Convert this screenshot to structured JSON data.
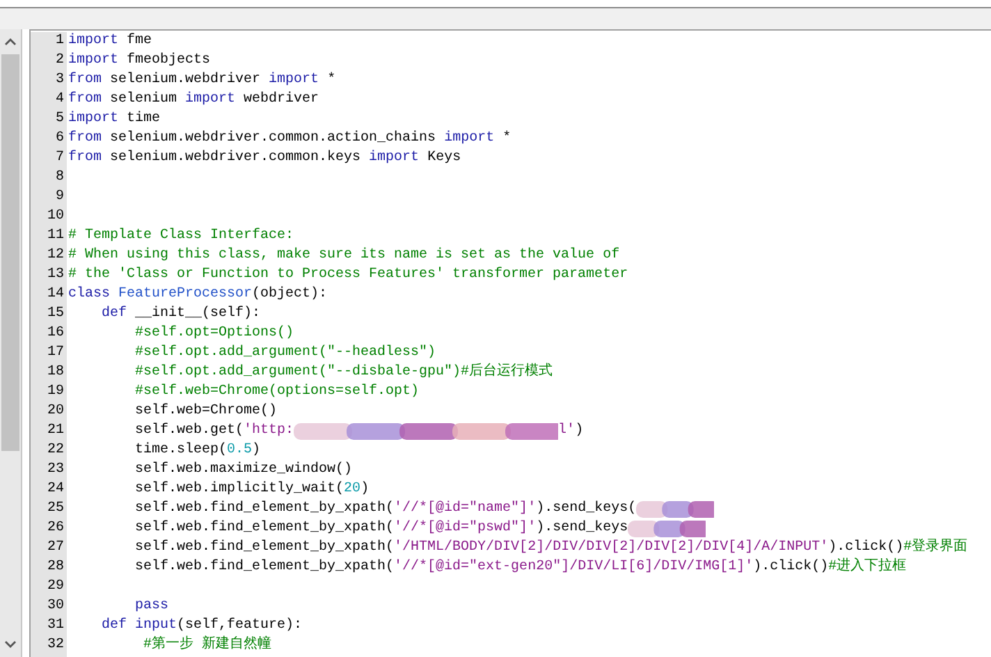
{
  "scrollbar": {
    "kind": "vertical"
  },
  "lines": [
    {
      "number": "1",
      "tokens": [
        {
          "kind": "kw",
          "text": "import"
        },
        {
          "kind": "plain",
          "text": " fme"
        }
      ]
    },
    {
      "number": "2",
      "tokens": [
        {
          "kind": "kw",
          "text": "import"
        },
        {
          "kind": "plain",
          "text": " fmeobjects"
        }
      ]
    },
    {
      "number": "3",
      "tokens": [
        {
          "kind": "kw",
          "text": "from"
        },
        {
          "kind": "plain",
          "text": " selenium.webdriver "
        },
        {
          "kind": "kw",
          "text": "import"
        },
        {
          "kind": "plain",
          "text": " *"
        }
      ]
    },
    {
      "number": "4",
      "tokens": [
        {
          "kind": "kw",
          "text": "from"
        },
        {
          "kind": "plain",
          "text": " selenium "
        },
        {
          "kind": "kw",
          "text": "import"
        },
        {
          "kind": "plain",
          "text": " webdriver"
        }
      ]
    },
    {
      "number": "5",
      "tokens": [
        {
          "kind": "kw",
          "text": "import"
        },
        {
          "kind": "plain",
          "text": " time"
        }
      ]
    },
    {
      "number": "6",
      "tokens": [
        {
          "kind": "kw",
          "text": "from"
        },
        {
          "kind": "plain",
          "text": " selenium.webdriver.common.action_chains "
        },
        {
          "kind": "kw",
          "text": "import"
        },
        {
          "kind": "plain",
          "text": " *"
        }
      ]
    },
    {
      "number": "7",
      "tokens": [
        {
          "kind": "kw",
          "text": "from"
        },
        {
          "kind": "plain",
          "text": " selenium.webdriver.common.keys "
        },
        {
          "kind": "kw",
          "text": "import"
        },
        {
          "kind": "plain",
          "text": " Keys"
        }
      ]
    },
    {
      "number": "8"
    },
    {
      "number": "9"
    },
    {
      "number": "10"
    },
    {
      "number": "11",
      "tokens": [
        {
          "kind": "comment",
          "text": "# Template Class Interface:"
        }
      ]
    },
    {
      "number": "12",
      "tokens": [
        {
          "kind": "comment",
          "text": "# When using this class, make sure its name is set as the value of"
        }
      ]
    },
    {
      "number": "13",
      "tokens": [
        {
          "kind": "comment",
          "text": "# the 'Class or Function to Process Features' transformer parameter"
        }
      ]
    },
    {
      "number": "14",
      "tokens": [
        {
          "kind": "kw",
          "text": "class"
        },
        {
          "kind": "name",
          "text": " FeatureProcessor"
        },
        {
          "kind": "plain",
          "text": "(object):"
        }
      ]
    },
    {
      "number": "15",
      "tokens": [
        {
          "kind": "kw",
          "text": "    def"
        },
        {
          "kind": "plain",
          "text": " __init__(self):"
        }
      ]
    },
    {
      "number": "16",
      "tokens": [
        {
          "kind": "comment",
          "text": "        #self.opt=Options()"
        }
      ]
    },
    {
      "number": "17",
      "tokens": [
        {
          "kind": "comment",
          "text": "        #self.opt.add_argument(\"--headless\")"
        }
      ]
    },
    {
      "number": "18",
      "tokens": [
        {
          "kind": "comment",
          "text": "        #self.opt.add_argument(\"--disbale-gpu\")#后台运行模式"
        }
      ]
    },
    {
      "number": "19",
      "tokens": [
        {
          "kind": "comment",
          "text": "        #self.web=Chrome(options=self.opt)"
        }
      ]
    },
    {
      "number": "20",
      "tokens": [
        {
          "kind": "plain",
          "text": "        self.web=Chrome()"
        }
      ]
    },
    {
      "number": "21",
      "tokens": [
        {
          "kind": "plain",
          "text": "        self.web.get("
        },
        {
          "kind": "string",
          "text": "'http:"
        },
        {
          "kind": "redaction_wide"
        },
        {
          "kind": "string",
          "text": "l'"
        },
        {
          "kind": "plain",
          "text": ")"
        }
      ]
    },
    {
      "number": "22",
      "tokens": [
        {
          "kind": "plain",
          "text": "        time.sleep("
        },
        {
          "kind": "number",
          "text": "0.5"
        },
        {
          "kind": "plain",
          "text": ")"
        }
      ]
    },
    {
      "number": "23",
      "tokens": [
        {
          "kind": "plain",
          "text": "        self.web.maximize_window()"
        }
      ]
    },
    {
      "number": "24",
      "tokens": [
        {
          "kind": "plain",
          "text": "        self.web.implicitly_wait("
        },
        {
          "kind": "number",
          "text": "20"
        },
        {
          "kind": "plain",
          "text": ")"
        }
      ]
    },
    {
      "number": "25",
      "tokens": [
        {
          "kind": "plain",
          "text": "        self.web.find_element_by_xpath("
        },
        {
          "kind": "string",
          "text": "'//*[@id=\"name\"]'"
        },
        {
          "kind": "plain",
          "text": ").send_keys("
        },
        {
          "kind": "redaction"
        }
      ]
    },
    {
      "number": "26",
      "tokens": [
        {
          "kind": "plain",
          "text": "        self.web.find_element_by_xpath("
        },
        {
          "kind": "string",
          "text": "'//*[@id=\"pswd\"]'"
        },
        {
          "kind": "plain",
          "text": ").send_keys"
        },
        {
          "kind": "redaction"
        }
      ]
    },
    {
      "number": "27",
      "tokens": [
        {
          "kind": "plain",
          "text": "        self.web.find_element_by_xpath("
        },
        {
          "kind": "string",
          "text": "'/HTML/BODY/DIV[2]/DIV/DIV[2]/DIV[2]/DIV[4]/A/INPUT'"
        },
        {
          "kind": "plain",
          "text": ").click()"
        },
        {
          "kind": "comment",
          "text": "#登录界面"
        }
      ]
    },
    {
      "number": "28",
      "tokens": [
        {
          "kind": "plain",
          "text": "        self.web.find_element_by_xpath("
        },
        {
          "kind": "string",
          "text": "'//*[@id=\"ext-gen20\"]/DIV/LI[6]/DIV/IMG[1]'"
        },
        {
          "kind": "plain",
          "text": ").click()"
        },
        {
          "kind": "comment",
          "text": "#进入下拉框"
        }
      ]
    },
    {
      "number": "29"
    },
    {
      "number": "30",
      "tokens": [
        {
          "kind": "kw",
          "text": "        pass"
        }
      ]
    },
    {
      "number": "31",
      "tokens": [
        {
          "kind": "kw",
          "text": "    def"
        },
        {
          "kind": "kw",
          "text": " input"
        },
        {
          "kind": "plain",
          "text": "(self,feature):"
        }
      ]
    },
    {
      "number": "32",
      "tokens": [
        {
          "kind": "comment",
          "text": "         #第一步 新建自然幢"
        }
      ]
    }
  ]
}
